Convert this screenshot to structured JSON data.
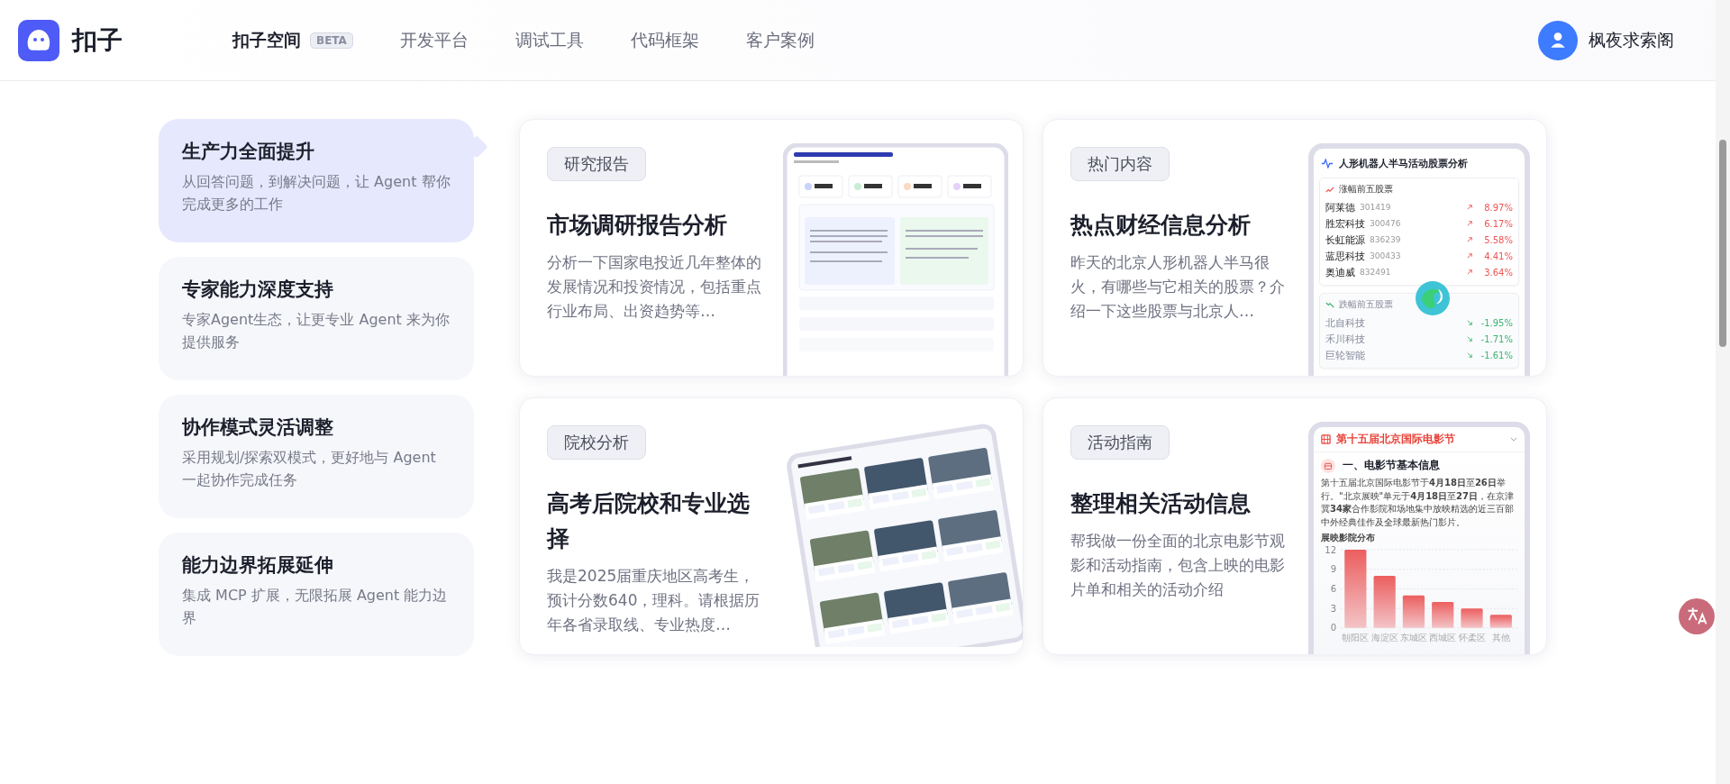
{
  "header": {
    "logo_text": "扣子",
    "nav": [
      {
        "label": "扣子空间",
        "badge": "BETA",
        "selected": true
      },
      {
        "label": "开发平台",
        "selected": false
      },
      {
        "label": "调试工具",
        "selected": false
      },
      {
        "label": "代码框架",
        "selected": false
      },
      {
        "label": "客户案例",
        "selected": false
      }
    ],
    "user": {
      "name": "枫夜求索阁"
    }
  },
  "features": [
    {
      "title": "生产力全面提升",
      "description": "从回答问题，到解决问题，让 Agent 帮你完成更多的工作",
      "selected": true
    },
    {
      "title": "专家能力深度支持",
      "description": "专家Agent生态，让更专业 Agent 来为你提供服务",
      "selected": false
    },
    {
      "title": "协作模式灵活调整",
      "description": "采用规划/探索双模式，更好地与 Agent 一起协作完成任务",
      "selected": false
    },
    {
      "title": "能力边界拓展延伸",
      "description": "集成 MCP 扩展，无限拓展 Agent 能力边界",
      "selected": false
    }
  ],
  "cases": [
    {
      "tag": "研究报告",
      "title": "市场调研报告分析",
      "description": "分析一下国家电投近几年整体的发展情况和投资情况，包括重点行业布局、出资趋势等…",
      "preview": {
        "kind": "report"
      }
    },
    {
      "tag": "热门内容",
      "title": "热点财经信息分析",
      "description": "昨天的北京人形机器人半马很火，有哪些与它相关的股票？介绍一下这些股票与北京人…",
      "preview": {
        "kind": "stocks",
        "title": "人形机器人半马活动股票分析",
        "sections": [
          {
            "heading": "涨幅前五股票",
            "color": "#f05252",
            "rows": [
              {
                "name": "阿莱德",
                "code": "301419",
                "change": "8.97%"
              },
              {
                "name": "胜宏科技",
                "code": "300476",
                "change": "6.17%"
              },
              {
                "name": "长虹能源",
                "code": "836239",
                "change": "5.58%"
              },
              {
                "name": "蓝思科技",
                "code": "300433",
                "change": "4.41%"
              },
              {
                "name": "奥迪威",
                "code": "832491",
                "change": "3.64%"
              }
            ]
          },
          {
            "heading": "跌幅前五股票",
            "color": "#3cb371",
            "rows": [
              {
                "name": "北自科技",
                "change": "-1.95%"
              },
              {
                "name": "禾川科技",
                "change": "-1.71%"
              },
              {
                "name": "巨轮智能",
                "change": "-1.61%"
              }
            ]
          }
        ]
      }
    },
    {
      "tag": "院校分析",
      "title": "高考后院校和专业选择",
      "description": "我是2025届重庆地区高考生，预计分数640，理科。请根据历年各省录取线、专业热度…",
      "preview": {
        "kind": "schools"
      }
    },
    {
      "tag": "活动指南",
      "title": "整理相关活动信息",
      "description": "帮我做一份全面的北京电影节观影和活动指南，包含上映的电影片单和相关的活动介绍",
      "preview": {
        "kind": "film",
        "title": "第十五届北京国际电影节",
        "section": "一、电影节基本信息",
        "paragraph": "第十五届北京国际电影节于**4月18日**至**26日**举行。\"北京展映\"单元于**4月18日**至**27日**，在京津冀**34家**合作影院和场地集中放映精选的近三百部中外经典佳作及全球最新热门影片。",
        "chart_data": {
          "type": "bar",
          "title": "展映影院分布",
          "categories": [
            "朝阳区",
            "海淀区",
            "东城区",
            "西城区",
            "怀柔区",
            "其他"
          ],
          "values": [
            12,
            8,
            5,
            4,
            3,
            2
          ],
          "ylim": [
            0,
            12
          ],
          "grid": true,
          "yticks": [
            0,
            3,
            6,
            9,
            12
          ]
        }
      }
    }
  ]
}
